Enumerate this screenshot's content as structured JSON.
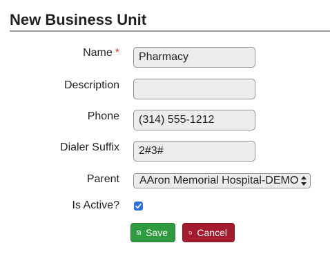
{
  "page": {
    "title": "New Business Unit"
  },
  "form": {
    "name": {
      "label": "Name",
      "required_marker": "*",
      "value": "Pharmacy"
    },
    "description": {
      "label": "Description",
      "value": ""
    },
    "phone": {
      "label": "Phone",
      "value": "(314) 555-1212"
    },
    "dialer_suffix": {
      "label": "Dialer Suffix",
      "value": "2#3#"
    },
    "parent": {
      "label": "Parent",
      "selected": "AAron Memorial Hospital-DEMO"
    },
    "is_active": {
      "label": "Is Active?",
      "checked": true
    }
  },
  "actions": {
    "save_label": "Save",
    "save_icon": "floppy-disk-icon",
    "cancel_label": "Cancel",
    "cancel_icon": "undo-arrow-icon"
  },
  "colors": {
    "save_button": "#2e9b41",
    "cancel_button": "#a21c2d",
    "required_marker": "#c0392b",
    "checkbox": "#2f6fdc"
  }
}
